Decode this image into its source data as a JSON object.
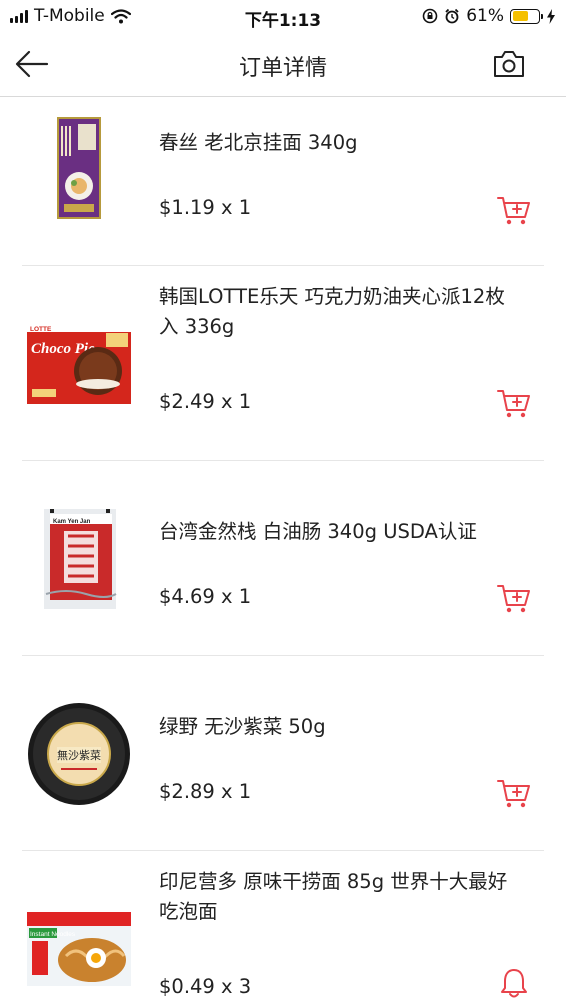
{
  "status_bar": {
    "carrier": "T-Mobile",
    "time": "下午1:13",
    "battery": "61%",
    "battery_level": 0.61
  },
  "nav": {
    "title": "订单详情",
    "back_icon": "arrow-left-icon",
    "camera_icon": "camera-icon"
  },
  "accent_color": "#e8434b",
  "items": [
    {
      "name": "春丝  老北京挂面 340g",
      "price": "$1.19 x 1",
      "action_icon": "add-to-cart-icon"
    },
    {
      "name": "韩国LOTTE乐天 巧克力奶油夹心派12枚入 336g",
      "price": "$2.49 x 1",
      "action_icon": "add-to-cart-icon"
    },
    {
      "name": "台湾金然栈 白油肠 340g USDA认证",
      "price": "$4.69 x 1",
      "action_icon": "add-to-cart-icon"
    },
    {
      "name": "绿野 无沙紫菜 50g",
      "price": "$2.89 x 1",
      "action_icon": "add-to-cart-icon"
    },
    {
      "name": "印尼营多 原味干捞面 85g 世界十大最好吃泡面",
      "price": "$0.49 x 3",
      "action_icon": "bell-icon"
    }
  ],
  "product_images": {
    "choco_pie_brand": "LOTTE",
    "choco_pie_text": "Choco Pie",
    "sausage_brand": "Kam Yen Jan",
    "seaweed_text": "無沙紫菜",
    "noodle_text": "Instant Noodles"
  }
}
